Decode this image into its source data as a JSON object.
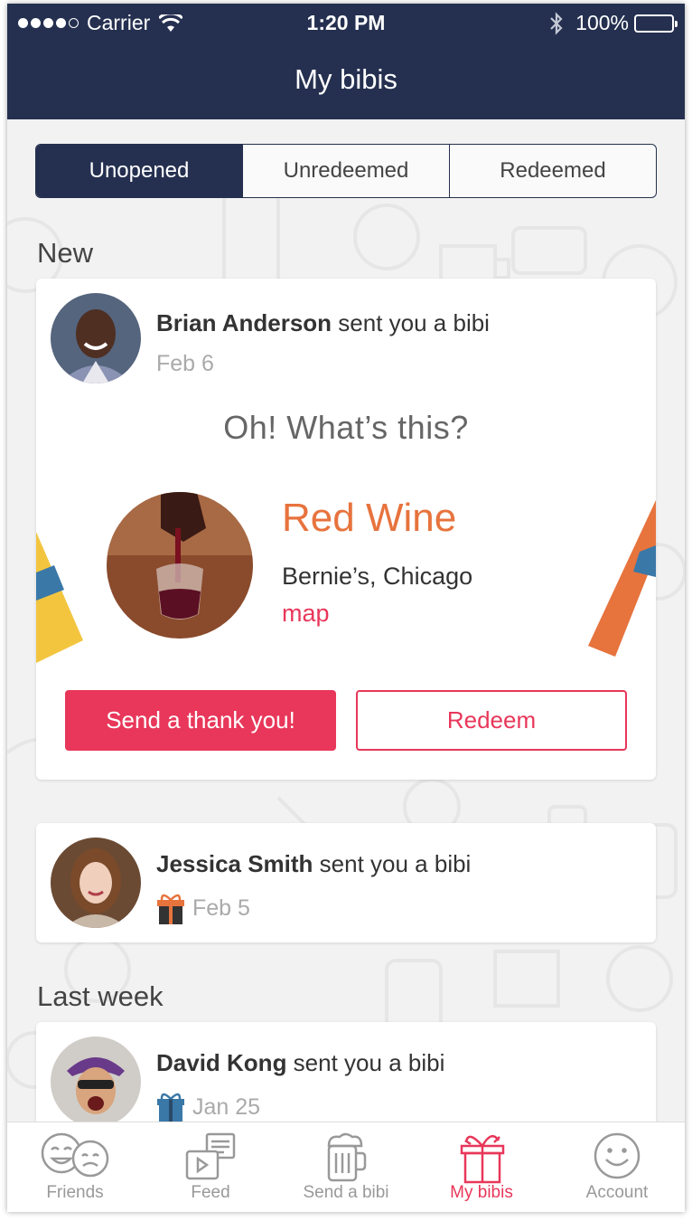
{
  "status_bar": {
    "carrier": "Carrier",
    "time": "1:20 PM",
    "battery": "100%"
  },
  "nav": {
    "title": "My bibis"
  },
  "segments": [
    {
      "label": "Unopened",
      "active": true
    },
    {
      "label": "Unredeemed",
      "active": false
    },
    {
      "label": "Redeemed",
      "active": false
    }
  ],
  "sections": {
    "new": "New",
    "last_week": "Last week"
  },
  "featured": {
    "sender": "Brian Anderson",
    "action": " sent you a bibi",
    "date": "Feb 6",
    "prompt": "Oh! What’s this?",
    "gift_name": "Red Wine",
    "place": "Bernie’s, Chicago",
    "map_label": "map",
    "thank_label": "Send a thank you!",
    "redeem_label": "Redeem"
  },
  "items": [
    {
      "sender": "Jessica Smith",
      "action": " sent you a bibi",
      "date": "Feb 5",
      "gift_color": "#e7733d"
    },
    {
      "sender": "David Kong",
      "action": " sent you a bibi",
      "date": "Jan 25",
      "gift_color": "#3a78a8"
    }
  ],
  "tabs": [
    {
      "label": "Friends",
      "icon": "friends-faces-icon",
      "active": false
    },
    {
      "label": "Feed",
      "icon": "feed-icon",
      "active": false
    },
    {
      "label": "Send a bibi",
      "icon": "beer-mug-icon",
      "active": false
    },
    {
      "label": "My bibis",
      "icon": "gift-box-icon",
      "active": true
    },
    {
      "label": "Account",
      "icon": "smiley-icon",
      "active": false
    }
  ],
  "colors": {
    "navy": "#253050",
    "accent_pink": "#e8375a",
    "accent_orange": "#e7733d"
  }
}
